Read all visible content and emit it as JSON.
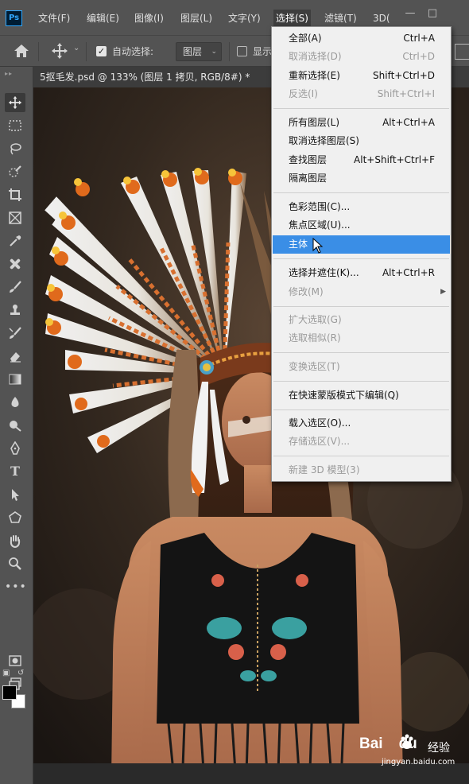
{
  "app": {
    "logo": "Ps"
  },
  "menubar": {
    "items": [
      {
        "label": "文件(F)"
      },
      {
        "label": "编辑(E)"
      },
      {
        "label": "图像(I)"
      },
      {
        "label": "图层(L)"
      },
      {
        "label": "文字(Y)"
      },
      {
        "label": "选择(S)"
      },
      {
        "label": "滤镜(T)"
      },
      {
        "label": "3D("
      }
    ]
  },
  "options": {
    "auto_select_label": "自动选择:",
    "auto_select_checked": true,
    "layer_select_value": "图层",
    "show_label": "显示"
  },
  "document": {
    "tab_title": "5抠毛发.psd @ 133% (图层 1 拷贝, RGB/8#) *"
  },
  "select_menu": {
    "items": [
      {
        "label": "全部(A)",
        "shortcut": "Ctrl+A",
        "enabled": true
      },
      {
        "label": "取消选择(D)",
        "shortcut": "Ctrl+D",
        "enabled": false
      },
      {
        "label": "重新选择(E)",
        "shortcut": "Shift+Ctrl+D",
        "enabled": true
      },
      {
        "label": "反选(I)",
        "shortcut": "Shift+Ctrl+I",
        "enabled": false
      },
      {
        "label": "所有图层(L)",
        "shortcut": "Alt+Ctrl+A",
        "enabled": true
      },
      {
        "label": "取消选择图层(S)",
        "shortcut": "",
        "enabled": true
      },
      {
        "label": "查找图层",
        "shortcut": "Alt+Shift+Ctrl+F",
        "enabled": true
      },
      {
        "label": "隔离图层",
        "shortcut": "",
        "enabled": true
      },
      {
        "label": "色彩范围(C)...",
        "shortcut": "",
        "enabled": true
      },
      {
        "label": "焦点区域(U)...",
        "shortcut": "",
        "enabled": true
      },
      {
        "label": "主体",
        "shortcut": "",
        "enabled": true,
        "highlighted": true
      },
      {
        "label": "选择并遮住(K)...",
        "shortcut": "Alt+Ctrl+R",
        "enabled": true
      },
      {
        "label": "修改(M)",
        "shortcut": "",
        "enabled": false,
        "submenu": true
      },
      {
        "label": "扩大选取(G)",
        "shortcut": "",
        "enabled": false
      },
      {
        "label": "选取相似(R)",
        "shortcut": "",
        "enabled": false
      },
      {
        "label": "变换选区(T)",
        "shortcut": "",
        "enabled": false
      },
      {
        "label": "在快速蒙版模式下编辑(Q)",
        "shortcut": "",
        "enabled": true
      },
      {
        "label": "载入选区(O)...",
        "shortcut": "",
        "enabled": true
      },
      {
        "label": "存储选区(V)...",
        "shortcut": "",
        "enabled": false
      },
      {
        "label": "新建 3D 模型(3)",
        "shortcut": "",
        "enabled": false
      }
    ]
  },
  "watermark": {
    "logo_text_1": "Bai",
    "logo_text_2": "du",
    "label": "经验",
    "url": "jingyan.baidu.com"
  },
  "colors": {
    "chrome": "#535353",
    "menu_bg": "#f0f0f0",
    "highlight": "#3a8ee6",
    "foreground": "#000000",
    "background": "#ffffff"
  }
}
